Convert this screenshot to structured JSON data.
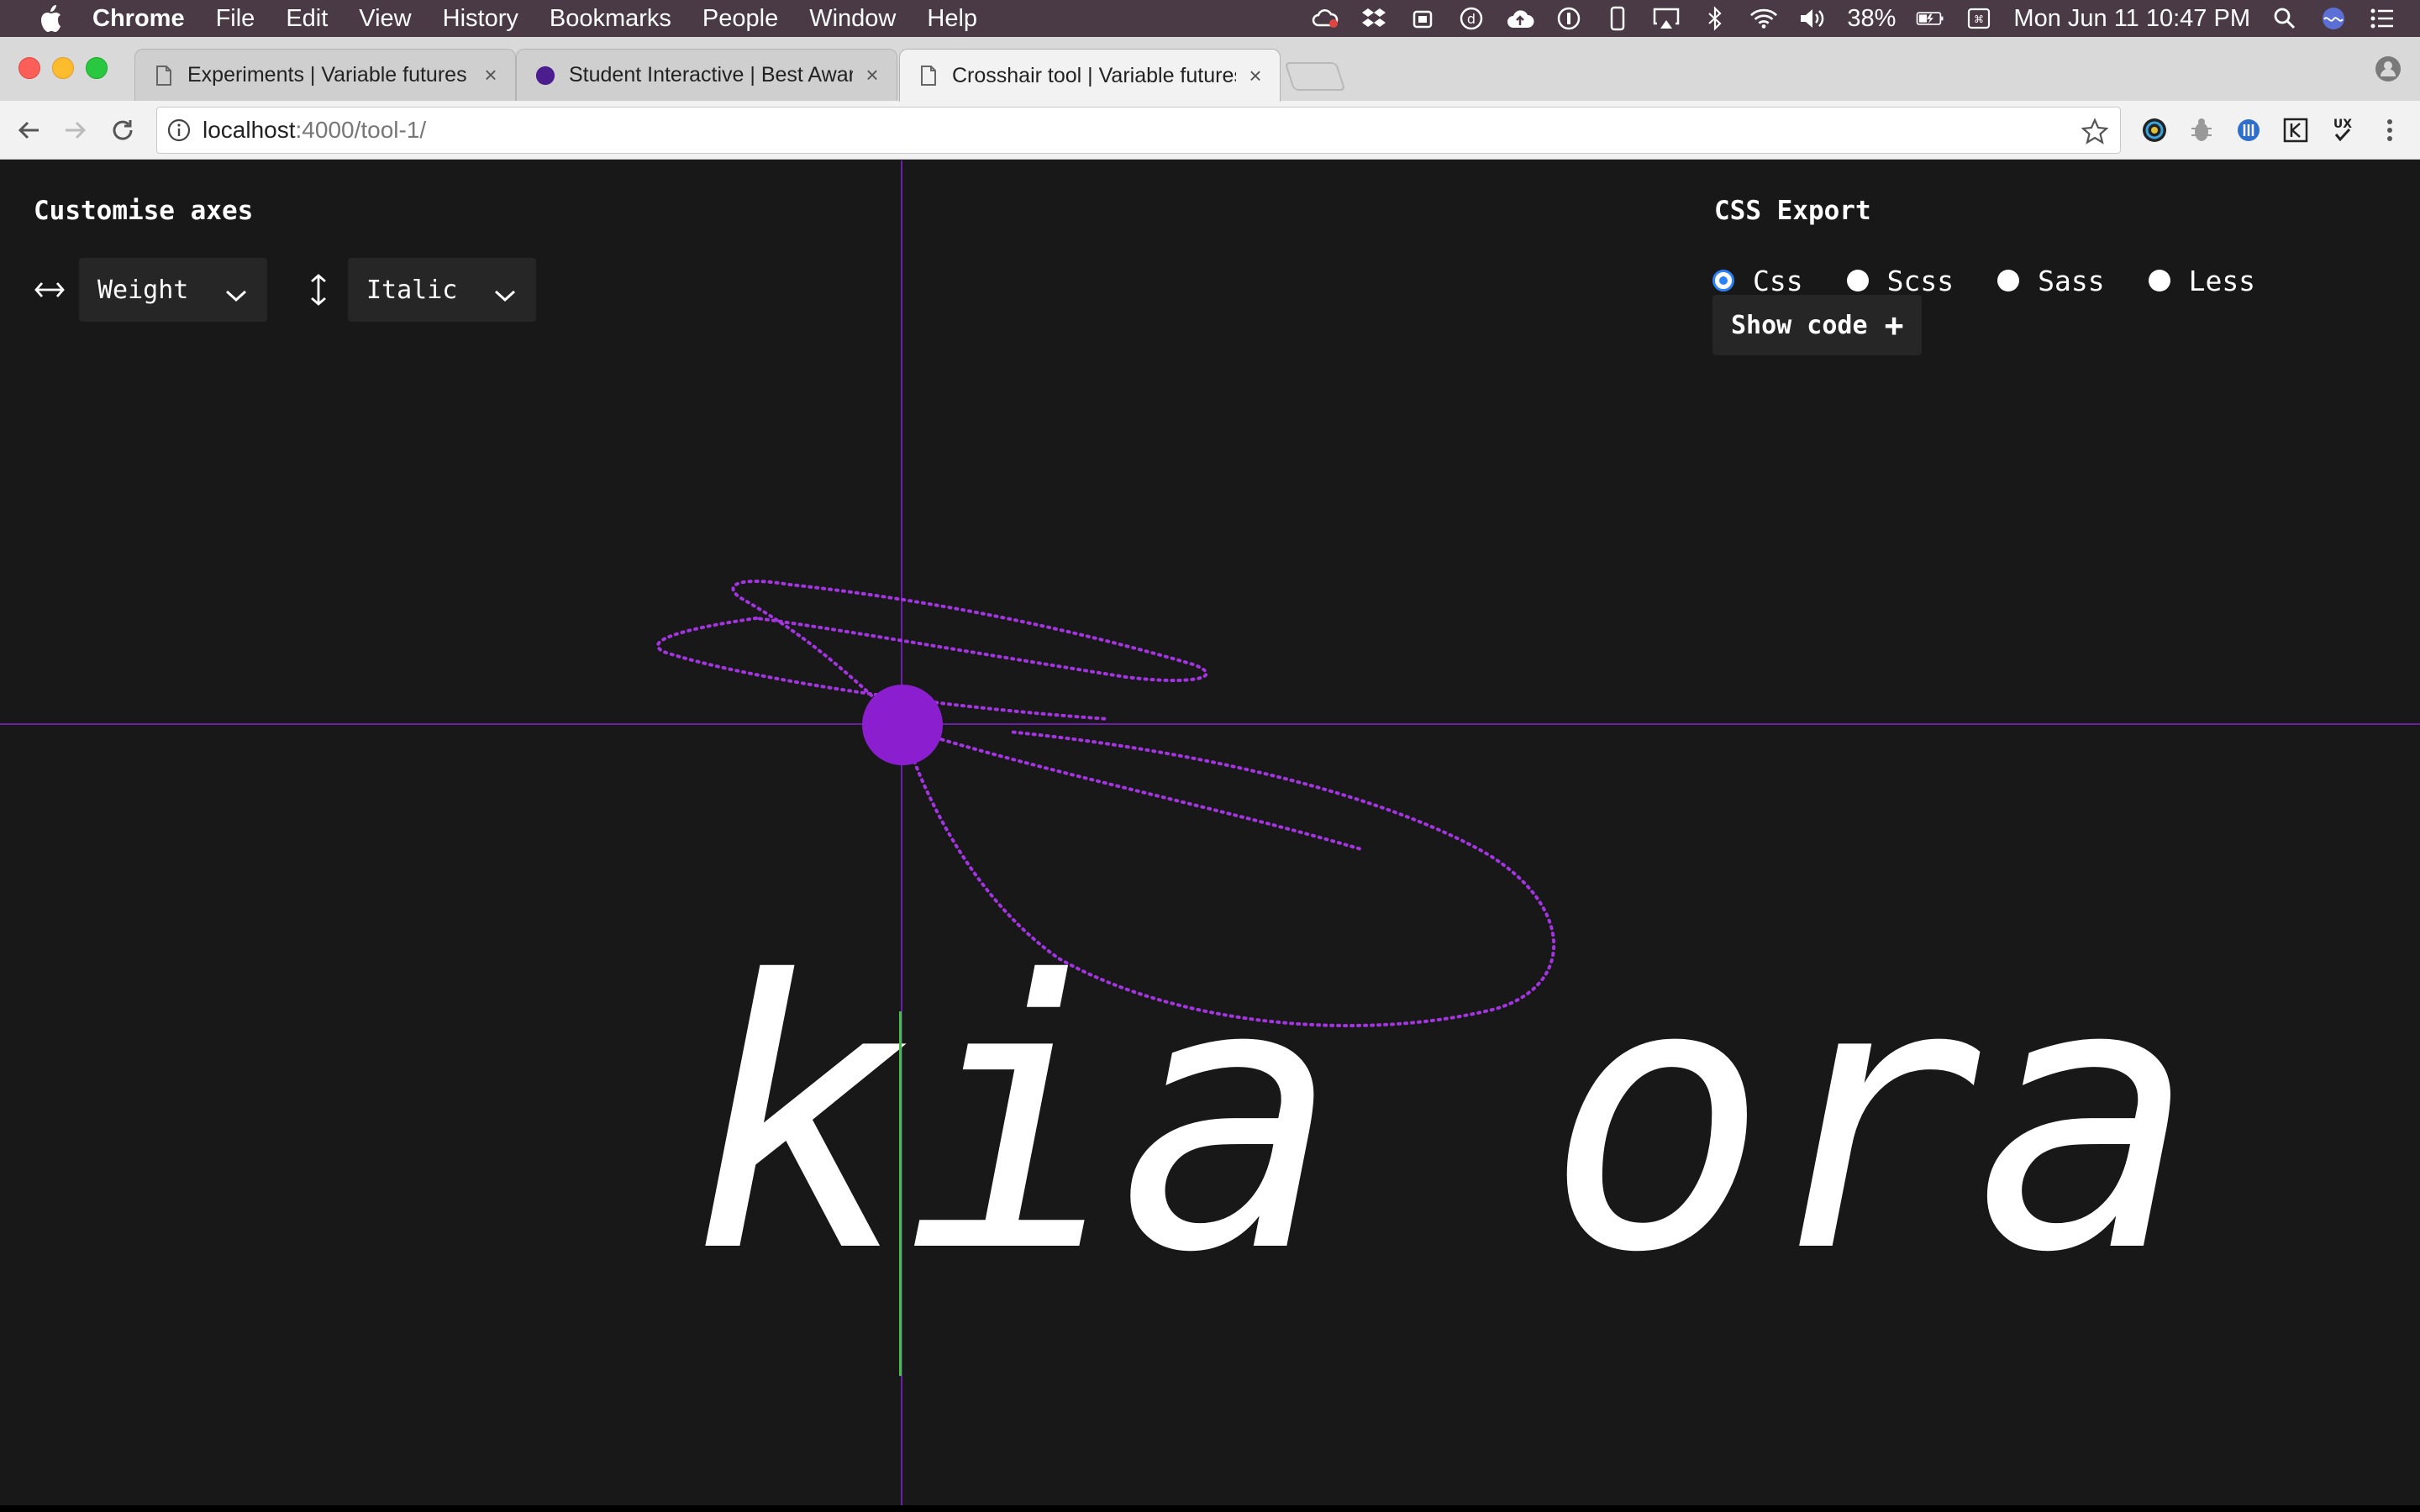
{
  "menubar": {
    "app_name": "Chrome",
    "menus": [
      "File",
      "Edit",
      "View",
      "History",
      "Bookmarks",
      "People",
      "Window",
      "Help"
    ],
    "battery": "38%",
    "clock": "Mon Jun 11  10:47 PM"
  },
  "tabs": [
    {
      "title": "Experiments | Variable futures",
      "close": "×",
      "favicon": "page-icon"
    },
    {
      "title": "Student Interactive | Best Awards",
      "close": "×",
      "favicon": "purple-circle-icon"
    },
    {
      "title": "Crosshair tool | Variable futures",
      "close": "×",
      "favicon": "page-icon",
      "active": true
    }
  ],
  "toolbar": {
    "url_host": "localhost",
    "url_rest": ":4000/tool-1/"
  },
  "page": {
    "customise_title": "Customise axes",
    "x_axis_select": "Weight",
    "y_axis_select": "Italic",
    "export_title": "CSS Export",
    "export_options": [
      {
        "label": "Css",
        "checked": true
      },
      {
        "label": "Scss",
        "checked": false
      },
      {
        "label": "Sass",
        "checked": false
      },
      {
        "label": "Less",
        "checked": false
      }
    ],
    "show_code": "Show code",
    "show_code_icon": "+",
    "sample_text": "kia ora"
  },
  "colors": {
    "background": "#181818",
    "crosshair": "#6b1fa8",
    "handle": "#8b1fcf",
    "trail": "#a335e0",
    "radio_accent": "#2b82f6"
  }
}
